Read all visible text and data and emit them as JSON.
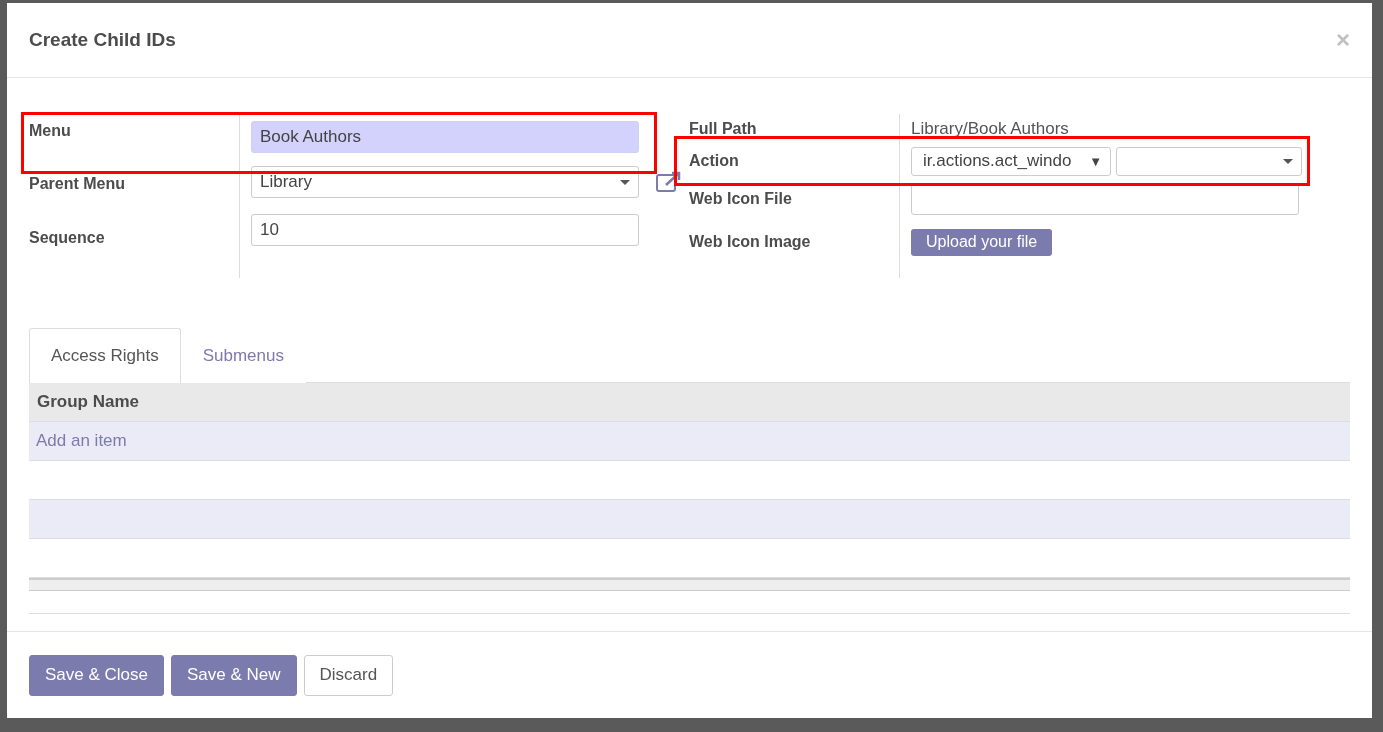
{
  "dialog": {
    "title": "Create Child IDs",
    "close": "×"
  },
  "left_fields": [
    {
      "label": "Menu",
      "kind": "text",
      "value": "Book Authors",
      "focused": true,
      "highlighted": true
    },
    {
      "label": "Parent Menu",
      "kind": "select",
      "value": "Library",
      "focused": false,
      "highlighted": false
    },
    {
      "label": "Sequence",
      "kind": "text",
      "value": "10",
      "focused": false,
      "highlighted": false
    }
  ],
  "right_fields": [
    {
      "label": "Full Path",
      "kind": "readonly",
      "value": "Library/Book Authors",
      "highlighted": false
    },
    {
      "label": "Action",
      "kind": "reference",
      "value": "ir.actions.act_windo",
      "arrow": "▼",
      "highlighted": true
    },
    {
      "label": "Web Icon File",
      "kind": "input",
      "highlighted": false
    },
    {
      "label": "Web Icon Image",
      "kind": "upload",
      "value": "Upload your file",
      "highlighted": false
    }
  ],
  "tabs": [
    {
      "label": "Access Rights",
      "selected": true
    },
    {
      "label": "Submenus",
      "selected": false
    }
  ],
  "table": {
    "columns": [
      "Group Name"
    ],
    "add_item": "Add an item"
  },
  "buttons": [
    {
      "label": "Save & Close",
      "kind": "primary"
    },
    {
      "label": "Save & New",
      "kind": "primary"
    },
    {
      "label": "Discard",
      "kind": "secondary"
    }
  ]
}
